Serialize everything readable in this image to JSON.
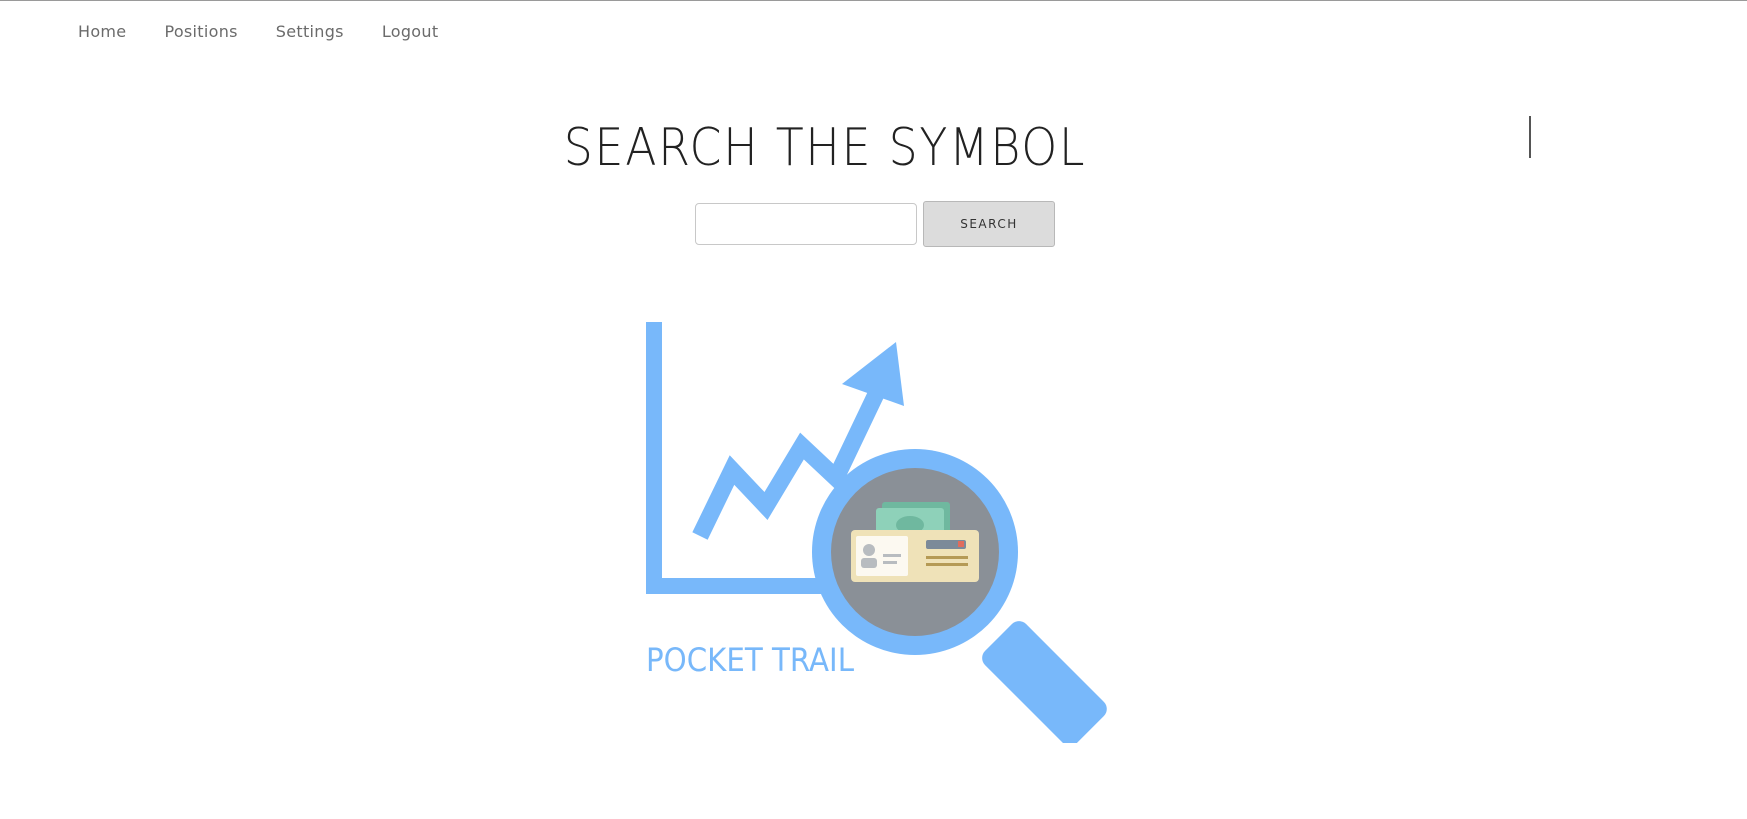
{
  "nav": {
    "items": [
      {
        "label": "Home"
      },
      {
        "label": "Positions"
      },
      {
        "label": "Settings"
      },
      {
        "label": "Logout"
      }
    ]
  },
  "main": {
    "title": "SEARCH THE SYMBOL",
    "search": {
      "value": "",
      "placeholder": "",
      "button_label": "SEARCH"
    }
  },
  "logo": {
    "text": "POCKET TRAIL",
    "icon": "chart-magnifier-wallet-icon"
  },
  "colors": {
    "accent": "#78b8fa",
    "lens_fill": "#8a9097",
    "wallet": "#efe2b8",
    "money": "#8ed1b9",
    "nav_text": "#6b6b6b",
    "title_text": "#222222"
  }
}
